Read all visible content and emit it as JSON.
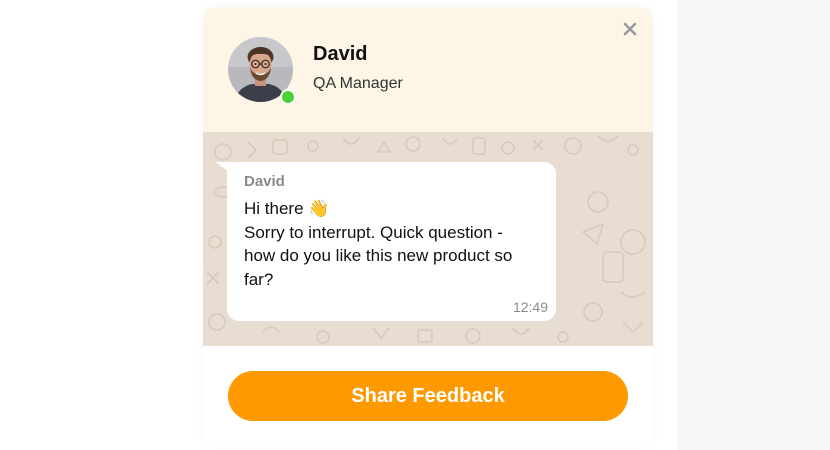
{
  "agent": {
    "name": "David",
    "role": "QA Manager",
    "status_color": "#4cd137"
  },
  "header": {
    "close_icon": "close-icon"
  },
  "message": {
    "sender": "David",
    "greeting": "Hi there 👋",
    "lines": [
      "Sorry to interrupt. Quick question -",
      "how do you like this new product so",
      "far?"
    ],
    "time": "12:49"
  },
  "cta": {
    "label": "Share Feedback",
    "color": "#ff9900"
  },
  "colors": {
    "header_bg": "#fdf6e6",
    "chat_bg": "#e7ddd1"
  }
}
